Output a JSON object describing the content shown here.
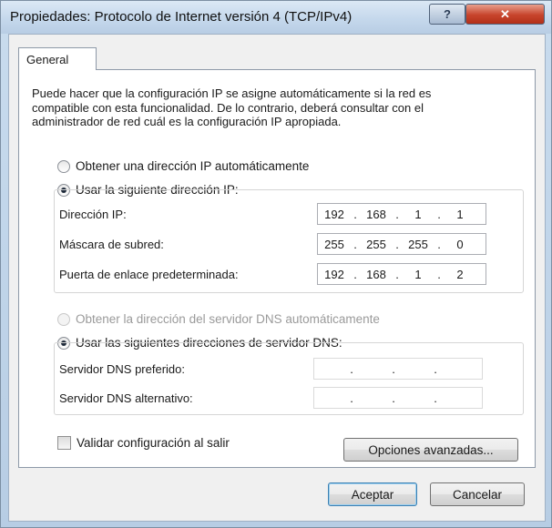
{
  "window": {
    "title": "Propiedades: Protocolo de Internet versión 4 (TCP/IPv4)",
    "help_label": "?",
    "close_label": "✕"
  },
  "tabs": [
    {
      "label": "General",
      "selected": true
    }
  ],
  "description": "Puede hacer que la configuración IP se asigne automáticamente si la red es compatible con esta funcionalidad. De lo contrario, deberá consultar con el administrador de red cuál es la configuración IP apropiada.",
  "ip": {
    "auto_label": "Obtener una dirección IP automáticamente",
    "manual_label": "Usar la siguiente dirección IP:",
    "selected": "manual",
    "fields": [
      {
        "label": "Dirección IP:",
        "octets": [
          "192",
          "168",
          "1",
          "1"
        ]
      },
      {
        "label": "Máscara de subred:",
        "octets": [
          "255",
          "255",
          "255",
          "0"
        ]
      },
      {
        "label": "Puerta de enlace predeterminada:",
        "octets": [
          "192",
          "168",
          "1",
          "2"
        ]
      }
    ]
  },
  "dns": {
    "auto_label": "Obtener la dirección del servidor DNS automáticamente",
    "manual_label": "Usar las siguientes direcciones de servidor DNS:",
    "selected": "manual",
    "fields": [
      {
        "label": "Servidor DNS preferido:",
        "octets": [
          "",
          "",
          "",
          ""
        ]
      },
      {
        "label": "Servidor DNS alternativo:",
        "octets": [
          "",
          "",
          "",
          ""
        ]
      }
    ]
  },
  "validate": {
    "label": "Validar configuración al salir",
    "checked": false
  },
  "buttons": {
    "advanced": "Opciones avanzadas...",
    "ok": "Aceptar",
    "cancel": "Cancelar"
  }
}
